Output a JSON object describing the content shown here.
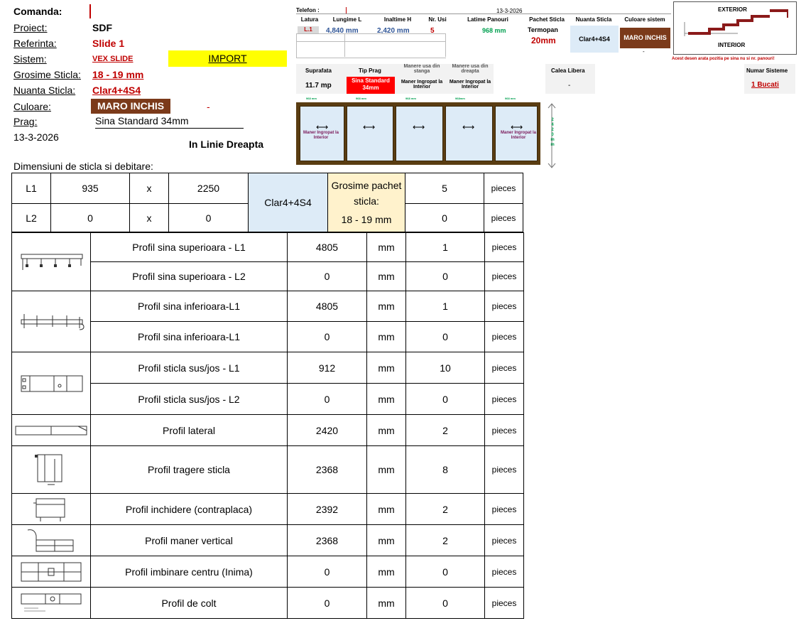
{
  "info": {
    "comanda_label": "Comanda:",
    "proiect_label": "Proiect:",
    "proiect": "SDF",
    "referinta_label": "Referinta:",
    "referinta": "Slide 1",
    "sistem_label": "Sistem:",
    "sistem": "VEX SLIDE",
    "import": "IMPORT",
    "grosime_label": "Grosime Sticla:",
    "grosime": "18 - 19 mm",
    "nuanta_label": "Nuanta Sticla:",
    "nuanta": "Clar4+4S4",
    "culoare_label": "Culoare:",
    "culoare": "MARO INCHIS",
    "dash": "-",
    "prag_label": "Prag:",
    "prag": "Sina Standard 34mm",
    "date": "13-3-2026",
    "linie": "In Linie Dreapta",
    "dim_title": "Dimensiuni de sticla si debitare:"
  },
  "summary": {
    "telefon": "Telefon :",
    "date": "13-3-2026",
    "headers": [
      "Latura",
      "Lungime L",
      "Inaltime H",
      "Nr. Usi",
      "Latime Panouri",
      "Pachet Sticla",
      "Nuanta Sticla",
      "Culoare sistem"
    ],
    "latura": "L.1",
    "lungime": "4,840 mm",
    "inaltime": "2,420 mm",
    "nr_usi": "5",
    "latime_panouri": "968 mm",
    "pachet_1": "Termopan",
    "pachet_2": "20mm",
    "nuanta": "Clar4+4S4",
    "culoare": "MARO INCHIS",
    "culoare_dash": "-",
    "exterior": "EXTERIOR",
    "interior": "INTERIOR",
    "warning": "Acest desen arata pozitia pe sina nu si nr. panouri!",
    "suprafata_h": "Suprafata",
    "suprafata": "11.7 mp",
    "tip_prag_h": "Tip Prag",
    "tip_prag": "Sina Standard 34mm",
    "manere_st_h": "Manere usa din stanga",
    "manere_st": "Maner Ingropat la Interior",
    "manere_dr_h": "Manere usa din dreapta",
    "manere_dr": "Maner Ingropat la Interior",
    "calea_h": "Calea Libera",
    "calea": "-",
    "numar_h": "Numar Sisteme",
    "numar": "1 Bucati",
    "panel_widths": [
      "968 mm",
      "968 mm",
      "968 mm",
      "968mm",
      "968 mm"
    ],
    "maner_left": "Maner Ingropat la Interior",
    "maner_right": "Maner Ingropat la Interior",
    "height_digits": [
      "2",
      "4",
      "2",
      "0",
      "m",
      "m"
    ]
  },
  "glass": {
    "rows": [
      {
        "l": "L1",
        "w": "935",
        "x": "x",
        "h": "2250",
        "qty": "5",
        "unit": "pieces"
      },
      {
        "l": "L2",
        "w": "0",
        "x": "x",
        "h": "0",
        "qty": "0",
        "unit": "pieces"
      }
    ],
    "nuanta": "Clar4+4S4",
    "grosime_title": "Grosime pachet sticla:",
    "grosime": "18 - 19 mm"
  },
  "profiles": [
    {
      "name": "Profil sina superioara  - L1",
      "len": "4805",
      "unit": "mm",
      "qty": "1",
      "pcs": "pieces"
    },
    {
      "name": "Profil sina superioara  - L2",
      "len": "0",
      "unit": "mm",
      "qty": "0",
      "pcs": "pieces"
    },
    {
      "name": "Profil sina inferioara-L1",
      "len": "4805",
      "unit": "mm",
      "qty": "1",
      "pcs": "pieces"
    },
    {
      "name": "Profil sina inferioara-L1",
      "len": "0",
      "unit": "mm",
      "qty": "0",
      "pcs": "pieces"
    },
    {
      "name": "Profil sticla sus/jos  - L1",
      "len": "912",
      "unit": "mm",
      "qty": "10",
      "pcs": "pieces"
    },
    {
      "name": "Profil sticla sus/jos  - L2",
      "len": "0",
      "unit": "mm",
      "qty": "0",
      "pcs": "pieces"
    },
    {
      "name": "Profil lateral",
      "len": "2420",
      "unit": "mm",
      "qty": "2",
      "pcs": "pieces"
    },
    {
      "name": "Profil tragere sticla",
      "len": "2368",
      "unit": "mm",
      "qty": "8",
      "pcs": "pieces"
    },
    {
      "name": "Profil inchidere (contraplaca)",
      "len": "2392",
      "unit": "mm",
      "qty": "2",
      "pcs": "pieces"
    },
    {
      "name": "Profil maner vertical",
      "len": "2368",
      "unit": "mm",
      "qty": "2",
      "pcs": "pieces"
    },
    {
      "name": "Profil imbinare centru (Inima)",
      "len": "0",
      "unit": "mm",
      "qty": "0",
      "pcs": "pieces"
    },
    {
      "name": "Profil de colt",
      "len": "0",
      "unit": "mm",
      "qty": "0",
      "pcs": "pieces"
    }
  ],
  "colors": {
    "brown": "#7b3a1a",
    "yellow": "#ffff00",
    "red": "#ff0000",
    "lightblue": "#ddebf7",
    "lightyellow": "#fff2cc",
    "darkred": "#c00000"
  }
}
